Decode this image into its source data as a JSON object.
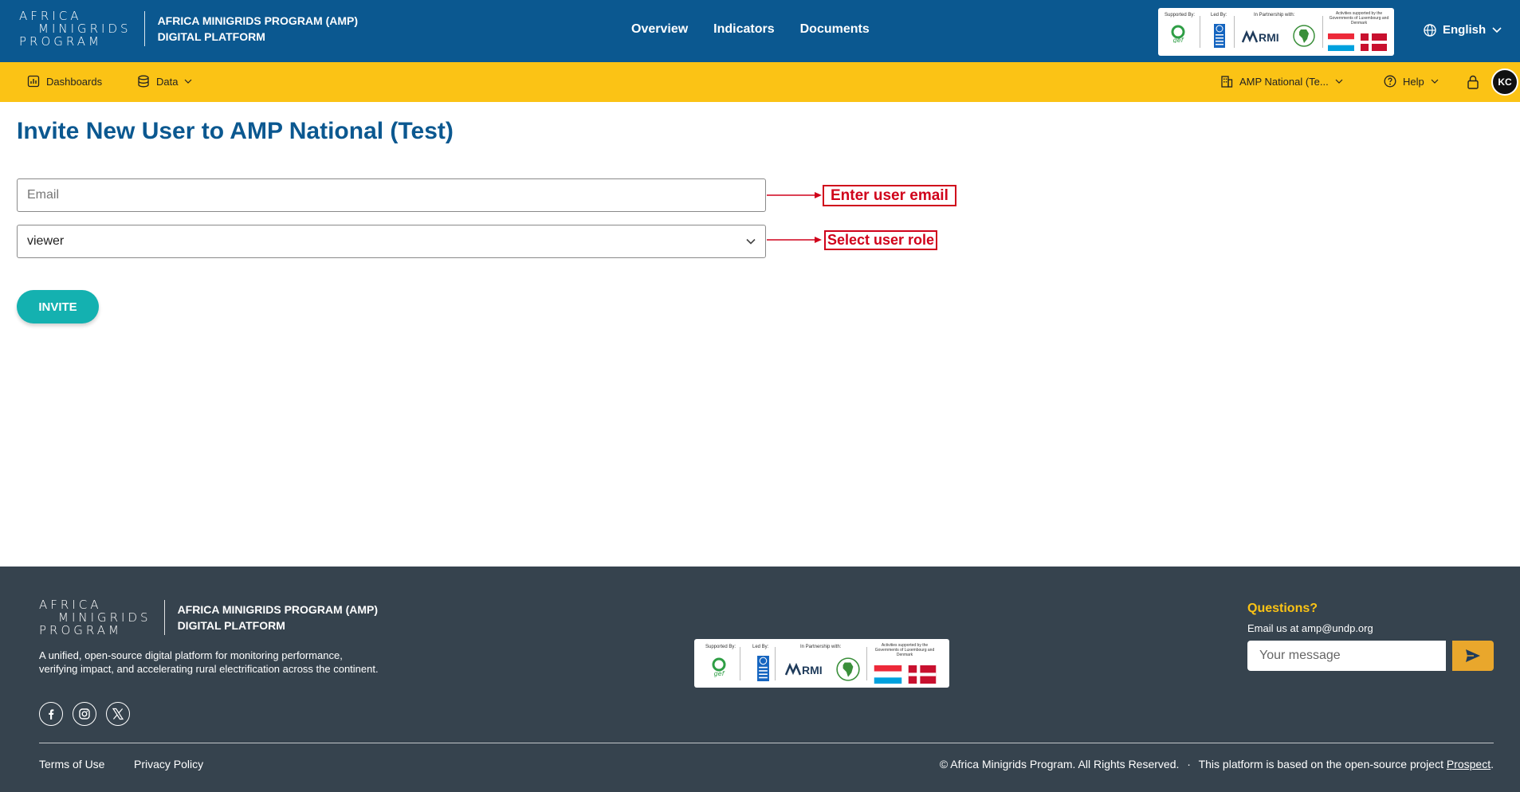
{
  "header": {
    "logo_lines": [
      "AFRICA",
      "MINIGRIDS",
      "PROGRAM"
    ],
    "title_line1": "AFRICA MINIGRIDS PROGRAM (AMP)",
    "title_line2": "DIGITAL PLATFORM",
    "nav": [
      {
        "label": "Overview"
      },
      {
        "label": "Indicators"
      },
      {
        "label": "Documents"
      }
    ],
    "partners": {
      "supported_by": "Supported By:",
      "gef": "gef",
      "led_by": "Led By:",
      "partnership": "In Partnership with:",
      "rmi": "RMI",
      "activities": "Activities supported by the Governments of Luxembourg and Denmark"
    },
    "language": "English"
  },
  "subnav": {
    "dashboards": "Dashboards",
    "data": "Data",
    "org": "AMP National (Te...",
    "help": "Help",
    "avatar": "KC"
  },
  "main": {
    "title": "Invite New User to AMP National (Test)",
    "email_placeholder": "Email",
    "role_value": "viewer",
    "invite_label": "INVITE",
    "annotation_email": "Enter user email",
    "annotation_role": "Select user role"
  },
  "footer": {
    "logo_lines": [
      "AFRICA",
      "MINIGRIDS",
      "PROGRAM"
    ],
    "title_line1": "AFRICA MINIGRIDS PROGRAM (AMP)",
    "title_line2": "DIGITAL PLATFORM",
    "description": "A unified, open-source digital platform for monitoring performance, verifying impact, and accelerating rural electrification across the continent.",
    "questions": "Questions?",
    "email_text": "Email us at amp@undp.org",
    "message_placeholder": "Your message",
    "terms": "Terms of Use",
    "privacy": "Privacy Policy",
    "copyright": "© Africa Minigrids Program. All Rights Reserved.",
    "separator": "·",
    "based_on": "This platform is based on the open-source project",
    "prospect": "Prospect",
    "period": "."
  },
  "colors": {
    "header_blue": "#0b5890",
    "subbar_yellow": "#fbc315",
    "invite_teal": "#14b1b0",
    "footer_bg": "#36434e",
    "annotation_red": "#d0021b"
  }
}
